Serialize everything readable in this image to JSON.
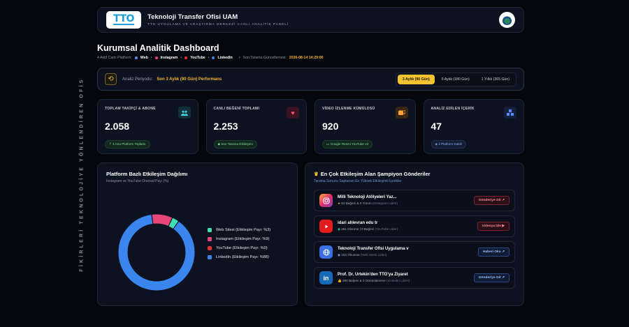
{
  "side_text": "FİKİRLERİ TEKNOLOJİYE YÖNLENDİREN OFİS",
  "header": {
    "logo_text": "TTO",
    "title": "Teknoloji Transfer Ofisi UAM",
    "subtitle": "TTO UYGULAMA VE ARAŞTIRMA MERKEZİ CANLI ANALİTİK PANELİ"
  },
  "page": {
    "title": "Kurumsal Analitik Dashboard",
    "meta_platforms": "4 Aktif Canlı Platform:",
    "platforms": [
      "Web",
      "Instagram",
      "YouTube",
      "LinkedIn"
    ],
    "last_scan_label": "Son Tarama Güncellemesi:",
    "last_scan_value": "2026-08-14 14:29:00"
  },
  "period": {
    "label": "Analiz Periyodu:",
    "value": "Son 3 Aylık (90 Gün) Performans",
    "options": [
      "3 Aylık (90 Gün)",
      "6 Aylık (180 Gün)",
      "1 Yıllık (365 Gün)"
    ],
    "selected_index": 0
  },
  "cards": [
    {
      "label": "TOPLAM TAKİPÇİ & ABONE",
      "value": "2.058",
      "chip": "4 Ana Platform Toplamı",
      "icon": "users-icon"
    },
    {
      "label": "CANLI BEĞENİ TOPLAMI",
      "value": "2.253",
      "chip": "Son Tarama Etkileşimi",
      "icon": "heart-icon"
    },
    {
      "label": "VİDEO İZLENME KÜMÜLDSÜ",
      "value": "920",
      "chip": "Google Resmi YouTube v3",
      "icon": "video-icon"
    },
    {
      "label": "ANALİZ EDİLEN İÇERİK",
      "value": "47",
      "chip": "4 Platform Kabili",
      "icon": "cubes-icon"
    }
  ],
  "distribution": {
    "title": "Platform Bazlı Etkileşim Dağılımı",
    "subtitle": "Instagram ve YouTube Oransal Payı (%)",
    "legend": [
      {
        "label": "Web Sitesi (Etkileşim Payı: %3)",
        "color": "#3ee0b0"
      },
      {
        "label": "Instagram (Etkileşim Payı: %9)",
        "color": "#e8457a"
      },
      {
        "label": "YouTube (Etkileşim Payı: %0)",
        "color": "#e83030"
      },
      {
        "label": "LinkedIn (Etkileşim Payı: %88)",
        "color": "#3a86ee"
      }
    ]
  },
  "chart_data": {
    "type": "pie",
    "categories": [
      "Web Sitesi",
      "Instagram",
      "YouTube",
      "LinkedIn"
    ],
    "values": [
      3,
      9,
      0,
      88
    ],
    "colors": [
      "#3ee0b0",
      "#e8457a",
      "#e83030",
      "#3a86ee"
    ],
    "title": "Platform Bazlı Etkileşim Dağılımı",
    "legend_position": "right"
  },
  "champions": {
    "title": "En Çok Etkileşim Alan Şampiyon Gönderiler",
    "subtitle": "Tarama Sonucu Saptanan En Yüksek Etkileşimli İçerikler",
    "items": [
      {
        "icon": "instagram-icon",
        "title": "Milli Teknoloji Atölyeleri Yaz...",
        "stats": "62 Beğeni & 0 Yorum",
        "source": "(Instagram Lideri)",
        "button": "Gönderiye Git ↗",
        "style": "red"
      },
      {
        "icon": "youtube-icon",
        "title": "idari ahlevran edu tr",
        "stats": "251 İzlenme | 0 Beğeni",
        "source": "(YouTube Lider)",
        "button": "Videoya İzle ▶",
        "style": "red"
      },
      {
        "icon": "globe-icon",
        "title": "Teknoloji Transfer Ofisi Uygulama v",
        "stats": "153 Okunma",
        "source": "(Web Sitesi Lideri)",
        "button": "Haberi Oku ↗",
        "style": "blue"
      },
      {
        "icon": "linkedin-icon",
        "title": "Prof. Dr. Urtekin'den TTO'ya Ziyaret",
        "stats": "290 Beğeni & 0 Görüntülenme",
        "source": "(LinkedIn Lideri)",
        "button": "Gönderiye Git ↗",
        "style": "blue"
      }
    ]
  }
}
